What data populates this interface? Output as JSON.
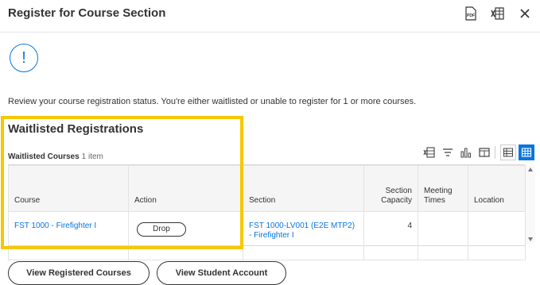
{
  "header": {
    "title": "Register for Course Section",
    "icons": [
      "pdf-icon",
      "export-to-excel-icon",
      "close-icon"
    ],
    "pdf_label": "PDF"
  },
  "alert": {
    "icon": "exclamation-circle-icon",
    "symbol": "!",
    "message": "Review your course registration status. You're either waitlisted or unable to register for 1 or more courses."
  },
  "waitlisted": {
    "title": "Waitlisted Registrations",
    "grid_label": "Waitlisted Courses",
    "count": "1 item",
    "toolbar_icons": [
      "export-to-excel-icon",
      "filter-icon",
      "chart-icon",
      "fullscreen-icon",
      "table-view-icon",
      "grid-view-icon"
    ],
    "columns": {
      "course": "Course",
      "action": "Action",
      "section": "Section",
      "section_capacity": "Section Capacity",
      "meeting_times": "Meeting Times",
      "location": "Location"
    },
    "rows": [
      {
        "course": "FST 1000 - Firefighter I",
        "action": "Drop",
        "section": "FST 1000-LV001 (E2E MTP2) - Firefighter I",
        "section_capacity": "4",
        "meeting_times": "",
        "location": ""
      }
    ]
  },
  "footer": {
    "view_registered": "View Registered Courses",
    "view_account": "View Student Account"
  },
  "colors": {
    "link": "#0875e1",
    "highlight": "#f5c800",
    "accent": "#0875e1"
  }
}
